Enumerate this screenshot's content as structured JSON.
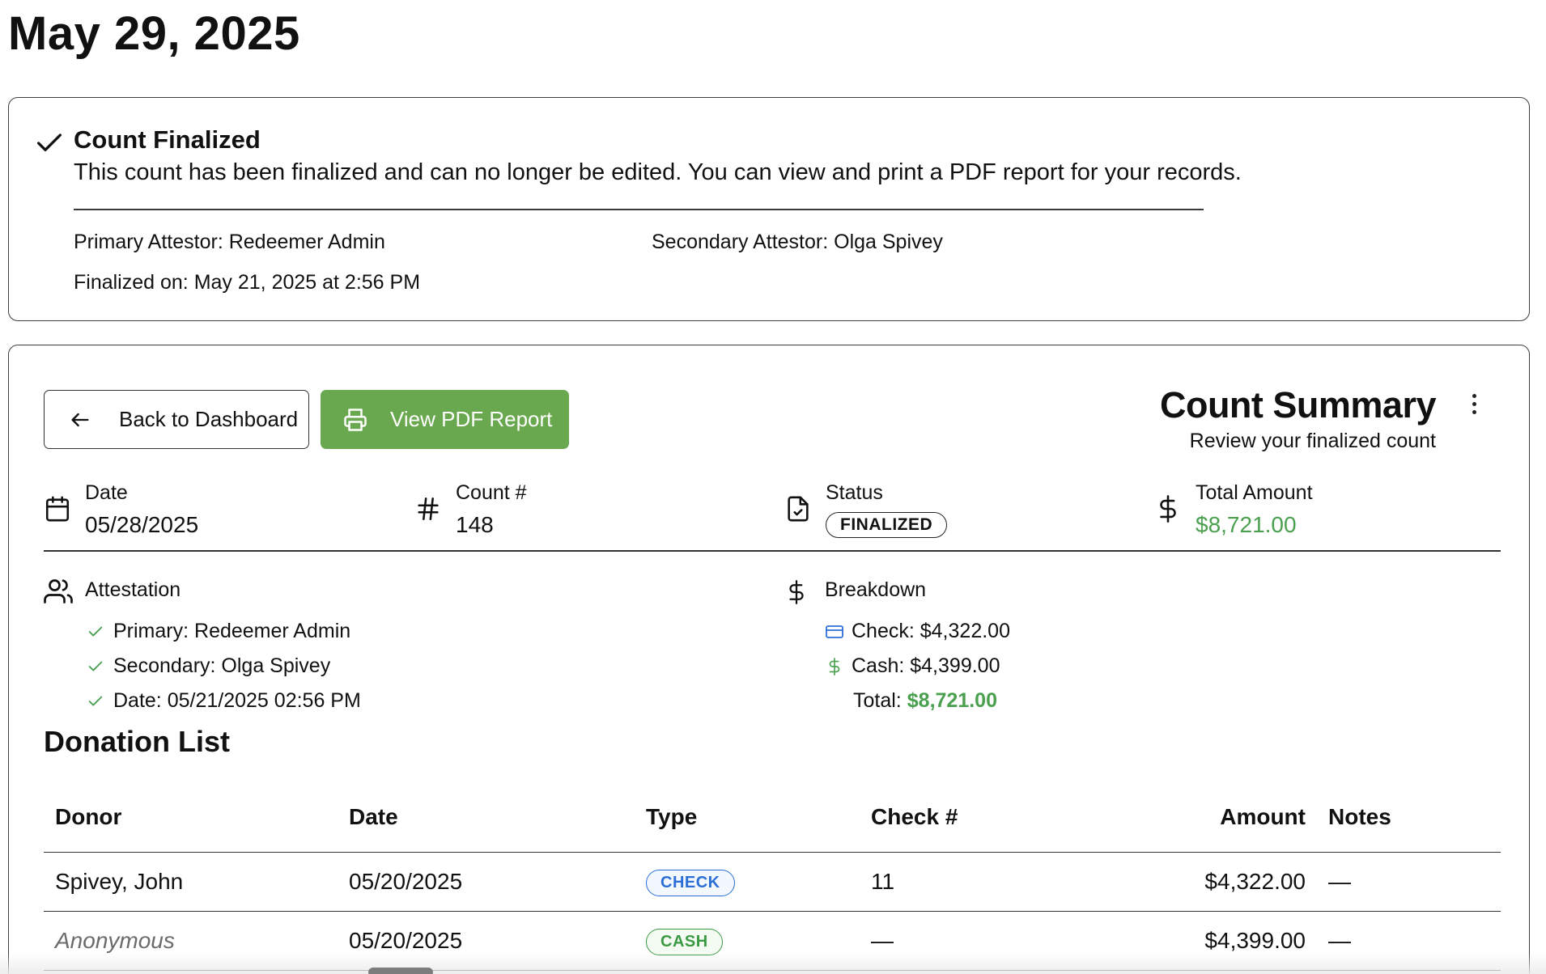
{
  "page": {
    "title": "May 29, 2025"
  },
  "notice": {
    "title": "Count Finalized",
    "text": "This count has been finalized and can no longer be edited. You can view and print a PDF report for your records.",
    "primary": "Primary Attestor: Redeemer Admin",
    "secondary": "Secondary Attestor: Olga Spivey",
    "finalized": "Finalized on: May 21, 2025 at 2:56 PM"
  },
  "toolbar": {
    "back_label": "Back to Dashboard",
    "pdf_label": "View PDF Report",
    "pdf_color": "#6aa84f"
  },
  "summary": {
    "title": "Count Summary",
    "subtitle": "Review your finalized count",
    "date_label": "Date",
    "date_value": "05/28/2025",
    "count_label": "Count #",
    "count_value": "148",
    "status_label": "Status",
    "status_value": "FINALIZED",
    "total_label": "Total Amount",
    "total_value": "$8,721.00",
    "accent_green": "#4aa04f"
  },
  "attestation": {
    "heading": "Attestation",
    "items": [
      {
        "label": "Primary:",
        "value": "Redeemer Admin"
      },
      {
        "label": "Secondary:",
        "value": "Olga Spivey"
      },
      {
        "label": "Date:",
        "value": "05/21/2025 02:56 PM"
      }
    ]
  },
  "breakdown": {
    "heading": "Breakdown",
    "check": "Check: $4,322.00",
    "cash": "Cash: $4,399.00",
    "total_label": "Total:",
    "total_value": "$8,721.00"
  },
  "donations": {
    "title": "Donation List",
    "columns": [
      "Donor",
      "Date",
      "Type",
      "Check #",
      "Amount",
      "Notes"
    ],
    "rows": [
      {
        "donor": "Spivey, John",
        "date": "05/20/2025",
        "type": "CHECK",
        "check_no": "11",
        "amount": "$4,322.00",
        "notes": "—"
      },
      {
        "donor": "Anonymous",
        "date": "05/20/2025",
        "type": "CASH",
        "check_no": "—",
        "amount": "$4,399.00",
        "notes": "—"
      }
    ]
  },
  "icons": [
    "check-icon",
    "arrow-left-icon",
    "printer-icon",
    "more-vertical-icon",
    "calendar-icon",
    "hash-icon",
    "file-check-icon",
    "dollar-icon",
    "users-icon",
    "credit-card-icon"
  ]
}
